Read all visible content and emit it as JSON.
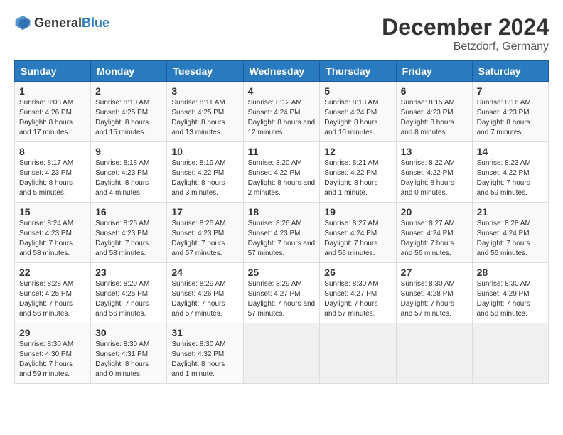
{
  "header": {
    "logo": {
      "general": "General",
      "blue": "Blue"
    },
    "title": "December 2024",
    "subtitle": "Betzdorf, Germany"
  },
  "calendar": {
    "days_of_week": [
      "Sunday",
      "Monday",
      "Tuesday",
      "Wednesday",
      "Thursday",
      "Friday",
      "Saturday"
    ],
    "weeks": [
      [
        {
          "day": "1",
          "sunrise": "8:08 AM",
          "sunset": "4:26 PM",
          "daylight": "8 hours and 17 minutes."
        },
        {
          "day": "2",
          "sunrise": "8:10 AM",
          "sunset": "4:25 PM",
          "daylight": "8 hours and 15 minutes."
        },
        {
          "day": "3",
          "sunrise": "8:11 AM",
          "sunset": "4:25 PM",
          "daylight": "8 hours and 13 minutes."
        },
        {
          "day": "4",
          "sunrise": "8:12 AM",
          "sunset": "4:24 PM",
          "daylight": "8 hours and 12 minutes."
        },
        {
          "day": "5",
          "sunrise": "8:13 AM",
          "sunset": "4:24 PM",
          "daylight": "8 hours and 10 minutes."
        },
        {
          "day": "6",
          "sunrise": "8:15 AM",
          "sunset": "4:23 PM",
          "daylight": "8 hours and 8 minutes."
        },
        {
          "day": "7",
          "sunrise": "8:16 AM",
          "sunset": "4:23 PM",
          "daylight": "8 hours and 7 minutes."
        }
      ],
      [
        {
          "day": "8",
          "sunrise": "8:17 AM",
          "sunset": "4:23 PM",
          "daylight": "8 hours and 5 minutes."
        },
        {
          "day": "9",
          "sunrise": "8:18 AM",
          "sunset": "4:23 PM",
          "daylight": "8 hours and 4 minutes."
        },
        {
          "day": "10",
          "sunrise": "8:19 AM",
          "sunset": "4:22 PM",
          "daylight": "8 hours and 3 minutes."
        },
        {
          "day": "11",
          "sunrise": "8:20 AM",
          "sunset": "4:22 PM",
          "daylight": "8 hours and 2 minutes."
        },
        {
          "day": "12",
          "sunrise": "8:21 AM",
          "sunset": "4:22 PM",
          "daylight": "8 hours and 1 minute."
        },
        {
          "day": "13",
          "sunrise": "8:22 AM",
          "sunset": "4:22 PM",
          "daylight": "8 hours and 0 minutes."
        },
        {
          "day": "14",
          "sunrise": "8:23 AM",
          "sunset": "4:22 PM",
          "daylight": "7 hours and 59 minutes."
        }
      ],
      [
        {
          "day": "15",
          "sunrise": "8:24 AM",
          "sunset": "4:23 PM",
          "daylight": "7 hours and 58 minutes."
        },
        {
          "day": "16",
          "sunrise": "8:25 AM",
          "sunset": "4:23 PM",
          "daylight": "7 hours and 58 minutes."
        },
        {
          "day": "17",
          "sunrise": "8:25 AM",
          "sunset": "4:23 PM",
          "daylight": "7 hours and 57 minutes."
        },
        {
          "day": "18",
          "sunrise": "8:26 AM",
          "sunset": "4:23 PM",
          "daylight": "7 hours and 57 minutes."
        },
        {
          "day": "19",
          "sunrise": "8:27 AM",
          "sunset": "4:24 PM",
          "daylight": "7 hours and 56 minutes."
        },
        {
          "day": "20",
          "sunrise": "8:27 AM",
          "sunset": "4:24 PM",
          "daylight": "7 hours and 56 minutes."
        },
        {
          "day": "21",
          "sunrise": "8:28 AM",
          "sunset": "4:24 PM",
          "daylight": "7 hours and 56 minutes."
        }
      ],
      [
        {
          "day": "22",
          "sunrise": "8:28 AM",
          "sunset": "4:25 PM",
          "daylight": "7 hours and 56 minutes."
        },
        {
          "day": "23",
          "sunrise": "8:29 AM",
          "sunset": "4:25 PM",
          "daylight": "7 hours and 56 minutes."
        },
        {
          "day": "24",
          "sunrise": "8:29 AM",
          "sunset": "4:26 PM",
          "daylight": "7 hours and 57 minutes."
        },
        {
          "day": "25",
          "sunrise": "8:29 AM",
          "sunset": "4:27 PM",
          "daylight": "7 hours and 57 minutes."
        },
        {
          "day": "26",
          "sunrise": "8:30 AM",
          "sunset": "4:27 PM",
          "daylight": "7 hours and 57 minutes."
        },
        {
          "day": "27",
          "sunrise": "8:30 AM",
          "sunset": "4:28 PM",
          "daylight": "7 hours and 57 minutes."
        },
        {
          "day": "28",
          "sunrise": "8:30 AM",
          "sunset": "4:29 PM",
          "daylight": "7 hours and 58 minutes."
        }
      ],
      [
        {
          "day": "29",
          "sunrise": "8:30 AM",
          "sunset": "4:30 PM",
          "daylight": "7 hours and 59 minutes."
        },
        {
          "day": "30",
          "sunrise": "8:30 AM",
          "sunset": "4:31 PM",
          "daylight": "8 hours and 0 minutes."
        },
        {
          "day": "31",
          "sunrise": "8:30 AM",
          "sunset": "4:32 PM",
          "daylight": "8 hours and 1 minute."
        },
        null,
        null,
        null,
        null
      ]
    ]
  }
}
